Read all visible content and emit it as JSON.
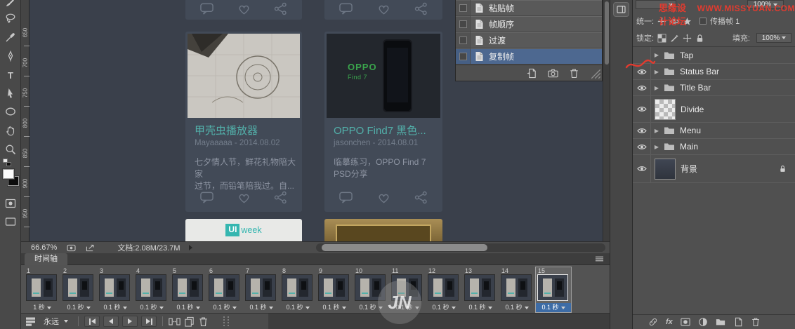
{
  "watermark": {
    "site": "思缘设计论坛",
    "url": "WWW.MISSYUAN.COM",
    "logo_text": "JN"
  },
  "toolbar": {
    "type_tool_glyph": "T",
    "tools": [
      "brush",
      "lasso",
      "eyedropper",
      "pen",
      "type",
      "path-selection",
      "ellipse",
      "hand",
      "zoom",
      "quick-mask",
      "screen-mode"
    ]
  },
  "ruler": {
    "labels": [
      "650",
      "700",
      "750",
      "800",
      "850",
      "900",
      "950"
    ]
  },
  "canvas": {
    "cards": {
      "beetle": {
        "title": "甲壳虫播放器",
        "meta": "Mayaaaaa - 2014.08.02",
        "desc1": "七夕情人节，鲜花礼物陪大家",
        "desc2": "过节，而铅笔陪我过。自..."
      },
      "oppo": {
        "logo_top": "OPPO",
        "logo_bottom": "Find 7",
        "title": "OPPO Find7 黑色...",
        "meta": "jasonchen - 2014.08.01",
        "desc1": "临摹练习，OPPO Find 7",
        "desc2": "PSD分享"
      },
      "uiweek": {
        "badge": "UI",
        "suffix": "week"
      }
    }
  },
  "history": {
    "items": [
      "粘贴帧",
      "帧顺序",
      "过渡",
      "复制帧"
    ],
    "selected_index": 3
  },
  "layers_panel": {
    "opacity_value": "100%",
    "unify_label": "统一:",
    "propagate_label": "传播帧 1",
    "lock_label": "锁定:",
    "fill_label": "填充:",
    "fill_value": "100%",
    "fx_label": "fx",
    "layers": [
      {
        "name": "Tap"
      },
      {
        "name": "Status Bar"
      },
      {
        "name": "Title Bar"
      },
      {
        "name": "Divide"
      },
      {
        "name": "Menu"
      },
      {
        "name": "Main"
      },
      {
        "name": "背景"
      }
    ]
  },
  "status_bar": {
    "zoom": "66.67%",
    "doc": "文档:2.08M/23.7M"
  },
  "timeline": {
    "tab": "时间轴",
    "loop": "永远",
    "frames": [
      {
        "n": "1",
        "d": "1 秒"
      },
      {
        "n": "2",
        "d": "0.1 秒"
      },
      {
        "n": "3",
        "d": "0.1 秒"
      },
      {
        "n": "4",
        "d": "0.1 秒"
      },
      {
        "n": "5",
        "d": "0.1 秒"
      },
      {
        "n": "6",
        "d": "0.1 秒"
      },
      {
        "n": "7",
        "d": "0.1 秒"
      },
      {
        "n": "8",
        "d": "0.1 秒"
      },
      {
        "n": "9",
        "d": "0.1 秒"
      },
      {
        "n": "10",
        "d": "0.1 秒"
      },
      {
        "n": "11",
        "d": "0.1 秒"
      },
      {
        "n": "12",
        "d": "0.1 秒"
      },
      {
        "n": "13",
        "d": "0.1 秒"
      },
      {
        "n": "14",
        "d": "0.1 秒"
      },
      {
        "n": "15",
        "d": "0.1 秒"
      }
    ]
  },
  "icons": {
    "disclosure": "▶"
  },
  "colors": {
    "accent_teal": "#52b0aa",
    "watermark_red": "#e23b2f",
    "selection_blue": "#4d6890",
    "oppo_green": "#3aa54c",
    "design_background": "#3a404b"
  }
}
